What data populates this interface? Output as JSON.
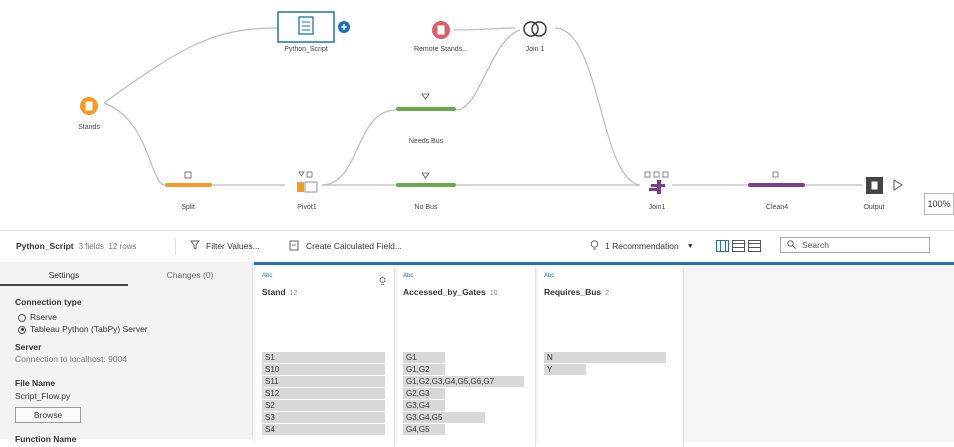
{
  "flow": {
    "nodes": {
      "python_script": "Python_Script",
      "remote_stands": "Remote Stands...",
      "join1_top": "Join 1",
      "stands": "Stands",
      "needs_bus": "Needs Bus",
      "split": "Split",
      "pivot1": "Pivot1",
      "no_bus": "No Bus",
      "join1": "Join1",
      "clean4": "Clean4",
      "output": "Output"
    },
    "zoom": "100%"
  },
  "toolbar": {
    "step_name": "Python_Script",
    "meta": "3 fields  12 rows",
    "filter_values": "Filter Values...",
    "create_calc": "Create Calculated Field...",
    "recommendation": "1 Recommendation",
    "search_placeholder": "Search"
  },
  "left_panel": {
    "tabs": [
      "Settings",
      "Changes (0)"
    ],
    "connection_type_label": "Connection type",
    "options": [
      "Rserve",
      "Tableau Python (TabPy) Server"
    ],
    "selected_option": 1,
    "server_label": "Server",
    "server_value": "Connection to localhost: 9004",
    "file_name_label": "File Name",
    "file_name_value": "Script_Flow.py",
    "browse_label": "Browse",
    "function_name_label": "Function Name"
  },
  "grid": {
    "columns": [
      {
        "type": "Abc",
        "name": "Stand",
        "count": "12",
        "values": [
          "S1",
          "S10",
          "S11",
          "S12",
          "S2",
          "S3",
          "S4"
        ]
      },
      {
        "type": "Abc",
        "name": "Accessed_by_Gates",
        "count": "10",
        "values": [
          "G1",
          "G1,G2",
          "G1,G2,G3,G4,G5,G6,G7",
          "G2,G3",
          "G3,G4",
          "G3,G4,G5",
          "G4,G5"
        ]
      },
      {
        "type": "Abc",
        "name": "Requires_Bus",
        "count": "2",
        "values": [
          "N",
          "Y"
        ]
      }
    ]
  },
  "colors": {
    "accent": "#2a6ea3",
    "input": "#f59a23",
    "output_data": "#d95f6e",
    "clean": "#6aa84f",
    "join": "#7b3f8c",
    "script": "#1f6fb2"
  }
}
